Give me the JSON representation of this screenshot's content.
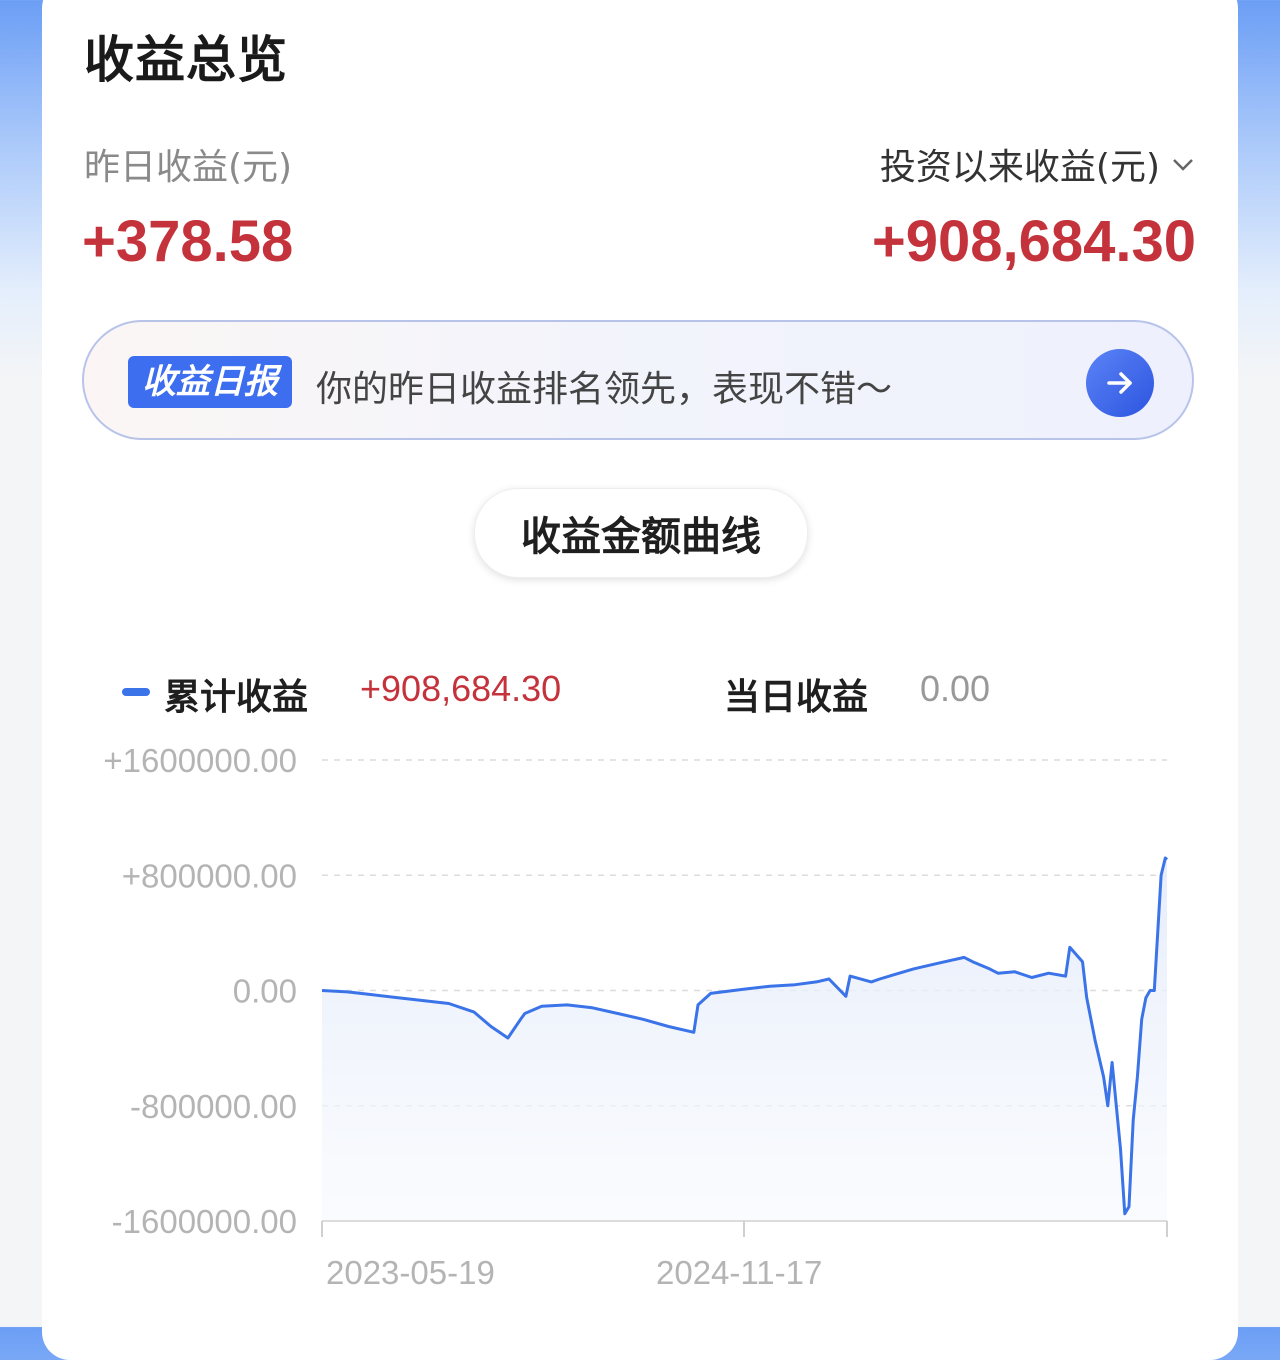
{
  "header": {
    "title": "收益总览"
  },
  "summary": {
    "yesterday_label": "昨日收益(元)",
    "yesterday_value": "+378.58",
    "total_label": "投资以来收益(元)",
    "total_value": "+908,684.30"
  },
  "banner": {
    "badge": "收益日报",
    "text": "你的昨日收益排名领先，表现不错～"
  },
  "chart_tab": {
    "label": "收益金额曲线"
  },
  "legend": {
    "series_name": "累计收益",
    "series_value": "+908,684.30",
    "daily_name": "当日收益",
    "daily_value": "0.00"
  },
  "colors": {
    "accent": "#3b73e8",
    "positive": "#c4333b",
    "badge": "#3e6ef0"
  },
  "chart_data": {
    "type": "line",
    "ylim": [
      -1600000,
      1600000
    ],
    "yticks": [
      "+1600000.00",
      "+800000.00",
      "0.00",
      "-800000.00",
      "-1600000.00"
    ],
    "xticks": [
      "2023-05-19",
      "2024-11-17"
    ],
    "grid": true,
    "series": [
      {
        "name": "累计收益",
        "x": [
          0.0,
          0.03,
          0.06,
          0.09,
          0.12,
          0.15,
          0.18,
          0.2,
          0.22,
          0.235,
          0.24,
          0.26,
          0.29,
          0.32,
          0.35,
          0.38,
          0.41,
          0.44,
          0.445,
          0.46,
          0.5,
          0.53,
          0.56,
          0.585,
          0.6,
          0.62,
          0.625,
          0.65,
          0.66,
          0.7,
          0.73,
          0.76,
          0.77,
          0.79,
          0.8,
          0.82,
          0.84,
          0.86,
          0.88,
          0.885,
          0.9,
          0.905,
          0.915,
          0.925,
          0.93,
          0.935,
          0.945,
          0.95,
          0.955,
          0.96,
          0.965,
          0.97,
          0.975,
          0.98,
          0.985,
          0.993,
          0.998,
          1.0
        ],
        "values": [
          0,
          -10000,
          -30000,
          -50000,
          -70000,
          -90000,
          -150000,
          -250000,
          -330000,
          -200000,
          -160000,
          -110000,
          -100000,
          -120000,
          -160000,
          -200000,
          -250000,
          -290000,
          -100000,
          -20000,
          10000,
          30000,
          40000,
          60000,
          80000,
          -40000,
          100000,
          60000,
          80000,
          150000,
          190000,
          230000,
          200000,
          150000,
          120000,
          130000,
          90000,
          120000,
          100000,
          300000,
          200000,
          -50000,
          -350000,
          -600000,
          -800000,
          -500000,
          -1100000,
          -1550000,
          -1500000,
          -900000,
          -600000,
          -200000,
          -50000,
          0,
          0,
          800000,
          920000,
          908684
        ]
      }
    ]
  }
}
